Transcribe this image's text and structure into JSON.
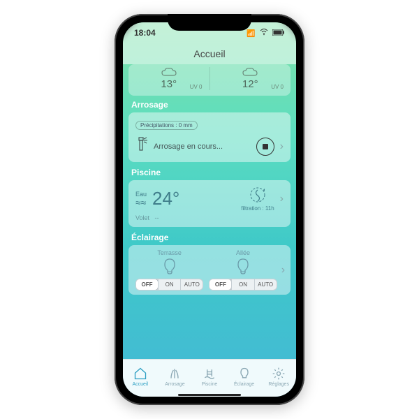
{
  "status": {
    "time": "18:04",
    "signal": "●●●",
    "wifi": "⌔",
    "battery": "▮"
  },
  "header": {
    "title": "Accueil"
  },
  "weather": [
    {
      "temp": "13°",
      "uv": "UV 0"
    },
    {
      "temp": "12°",
      "uv": "UV 0"
    }
  ],
  "arrosage": {
    "title": "Arrosage",
    "chip": "Précipitations : 0 mm",
    "status": "Arrosage en cours..."
  },
  "piscine": {
    "title": "Piscine",
    "eau_label": "Eau",
    "temp": "24°",
    "volet_label": "Volet",
    "volet_value": "--",
    "filtration": "filtration : 11h"
  },
  "eclairage": {
    "title": "Éclairage",
    "lights": [
      {
        "label": "Terrasse"
      },
      {
        "label": "Allée"
      }
    ],
    "seg": {
      "off": "OFF",
      "on": "ON",
      "auto": "AUTO"
    }
  },
  "tabs": [
    {
      "label": "Accueil"
    },
    {
      "label": "Arrosage"
    },
    {
      "label": "Piscine"
    },
    {
      "label": "Éclairage"
    },
    {
      "label": "Réglages"
    }
  ]
}
